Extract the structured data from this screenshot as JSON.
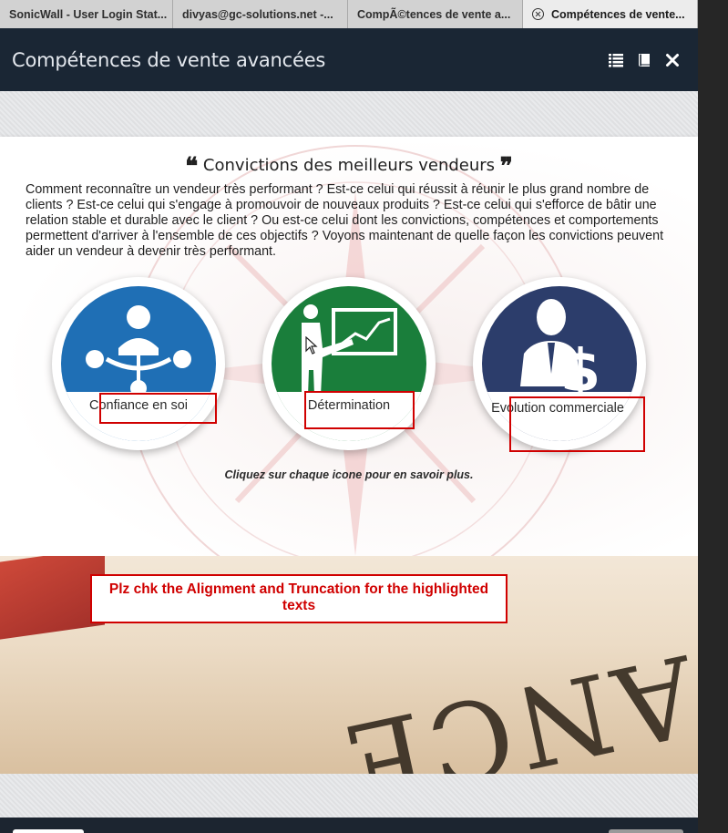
{
  "browser_tabs": [
    {
      "label": "SonicWall - User Login Stat..."
    },
    {
      "label": "divyas@gc-solutions.net -..."
    },
    {
      "label": "CompÃ©tences de vente a..."
    },
    {
      "label": "Compétences de vente..."
    }
  ],
  "course_header": {
    "title": "Compétences de vente avancées"
  },
  "slide": {
    "title": "Convictions des meilleurs vendeurs",
    "open_quote": "❝",
    "close_quote": "❞",
    "intro": "Comment reconnaître un vendeur très performant ? Est-ce celui qui réussit à réunir le plus grand nombre de clients ? Est-ce celui qui s'engage à promouvoir de nouveaux produits ? Est-ce celui qui s'efforce de bâtir une relation stable et durable avec le client ? Ou est-ce celui dont les convictions, compétences et comportements permettent d'arriver à l'ensemble de ces objectifs ? Voyons maintenant de quelle façon les convictions peuvent aider un vendeur à devenir très performant.",
    "icons": [
      {
        "label": "Confiance en soi",
        "color": "#1f6fb5"
      },
      {
        "label": "Détermination",
        "color": "#1a7e3b"
      },
      {
        "label": "Evolution commerciale",
        "color": "#2c3d6b"
      }
    ],
    "hint": "Cliquez sur chaque icone pour en savoir plus."
  },
  "review_note": "Plz chk the Alignment and Truncation for the highlighted texts",
  "colors": {
    "header_bg": "#1a2634",
    "highlight": "#d00000"
  }
}
